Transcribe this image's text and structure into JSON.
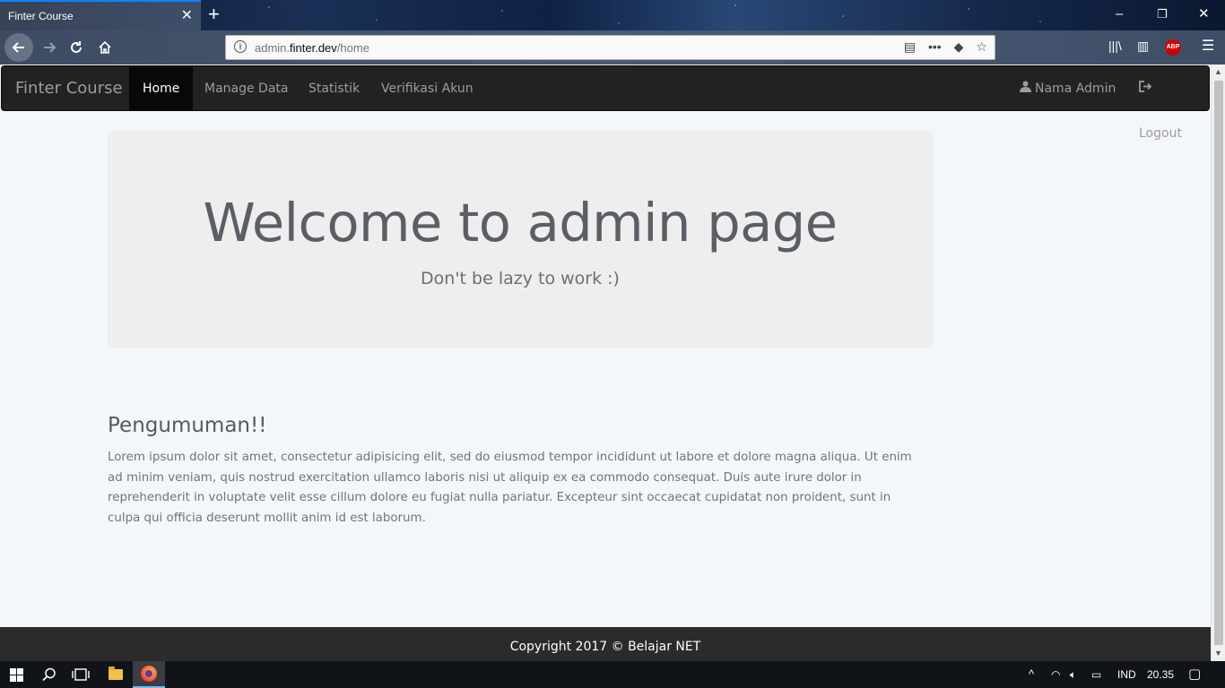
{
  "browser": {
    "tab_title": "Finter Course",
    "tab_close": "✕",
    "new_tab": "+",
    "url_prefix": "admin.",
    "url_host": "finter.dev",
    "url_path": "/home",
    "window_controls": {
      "minimize": "–",
      "restore": "❐",
      "close": "✕"
    }
  },
  "site_nav": {
    "brand": "Finter Course",
    "items": [
      {
        "label": "Home",
        "active": true
      },
      {
        "label": "Manage Data",
        "active": false
      },
      {
        "label": "Statistik",
        "active": false
      },
      {
        "label": "Verifikasi Akun",
        "active": false
      }
    ],
    "user_label": "Nama Admin",
    "logout_label": "Logout"
  },
  "jumbotron": {
    "title": "Welcome to admin page",
    "subtitle": "Don't be lazy to work :)"
  },
  "announcement": {
    "title": "Pengumuman!!",
    "body": "Lorem ipsum dolor sit amet, consectetur adipisicing elit, sed do eiusmod tempor incididunt ut labore et dolore magna aliqua. Ut enim ad minim veniam, quis nostrud exercitation ullamco laboris nisi ut aliquip ex ea commodo consequat. Duis aute irure dolor in reprehenderit in voluptate velit esse cillum dolore eu fugiat nulla pariatur. Excepteur sint occaecat cupidatat non proident, sunt in culpa qui officia deserunt mollit anim id est laborum."
  },
  "footer": {
    "copyright": "Copyright 2017 © Belajar NET"
  },
  "taskbar": {
    "language": "IND",
    "time": "20.35"
  },
  "colors": {
    "navbar_bg": "#222222",
    "page_bg": "#f4f7f9",
    "jumbotron_bg": "#eeeeee",
    "footer_bg": "#2b2b2b"
  }
}
